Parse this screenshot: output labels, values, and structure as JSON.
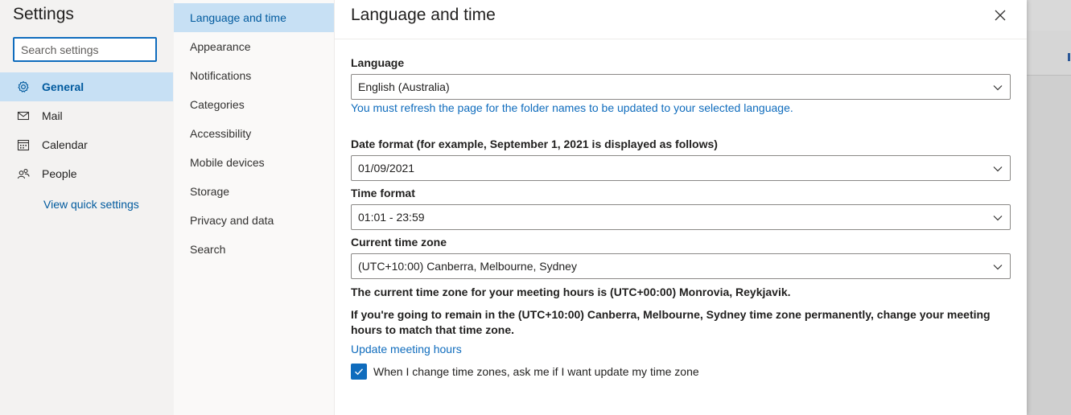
{
  "settings": {
    "title": "Settings",
    "search_placeholder": "Search settings",
    "categories": [
      {
        "label": "General",
        "icon": "gear-icon",
        "active": true
      },
      {
        "label": "Mail",
        "icon": "mail-icon",
        "active": false
      },
      {
        "label": "Calendar",
        "icon": "calendar-icon",
        "active": false
      },
      {
        "label": "People",
        "icon": "people-icon",
        "active": false
      }
    ],
    "quick_settings_link": "View quick settings"
  },
  "subnav": {
    "items": [
      {
        "label": "Language and time",
        "active": true
      },
      {
        "label": "Appearance",
        "active": false
      },
      {
        "label": "Notifications",
        "active": false
      },
      {
        "label": "Categories",
        "active": false
      },
      {
        "label": "Accessibility",
        "active": false
      },
      {
        "label": "Mobile devices",
        "active": false
      },
      {
        "label": "Storage",
        "active": false
      },
      {
        "label": "Privacy and data",
        "active": false
      },
      {
        "label": "Search",
        "active": false
      }
    ]
  },
  "content": {
    "title": "Language and time",
    "language": {
      "label": "Language",
      "value": "English (Australia)",
      "note": "You must refresh the page for the folder names to be updated to your selected language."
    },
    "date_format": {
      "label": "Date format (for example, September 1, 2021 is displayed as follows)",
      "value": "01/09/2021"
    },
    "time_format": {
      "label": "Time format",
      "value": "01:01 - 23:59"
    },
    "time_zone": {
      "label": "Current time zone",
      "value": "(UTC+10:00) Canberra, Melbourne, Sydney"
    },
    "meeting_notice": "The current time zone for your meeting hours is (UTC+00:00) Monrovia, Reykjavik.",
    "meeting_advice": "If you're going to remain in the (UTC+10:00) Canberra, Melbourne, Sydney time zone permanently, change your meeting hours to match that time zone.",
    "update_link": "Update meeting hours",
    "ask_checkbox": {
      "label": "When I change time zones, ask me if I want update my time zone",
      "checked": true
    }
  },
  "colors": {
    "accent": "#0f6cbd",
    "selected_bg": "#c7e0f4"
  }
}
